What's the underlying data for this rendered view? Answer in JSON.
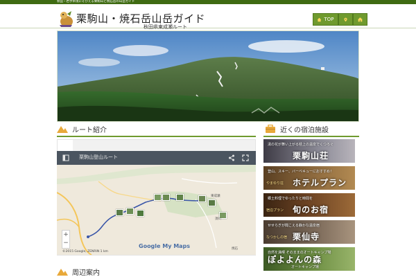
{
  "topbar": {
    "tagline": "秋田・岩手県境にそびえる栗駒山と焼石岳の山岳ガイド"
  },
  "header": {
    "title": "栗駒山・焼石岳山岳ガイド",
    "subtitle": "秋田県東成瀬ルート",
    "nav": [
      {
        "label": "TOP",
        "icon": "home-icon"
      },
      {
        "label": "",
        "icon": "pin-icon"
      },
      {
        "label": "",
        "icon": "hotel-icon"
      }
    ]
  },
  "main": {
    "section_title": "ルート紹介",
    "map": {
      "toolbar_title": "栗駒山登山ルート",
      "zoom_in": "+",
      "zoom_out": "−",
      "logo": "Google My Maps",
      "copyright": "©2015 Google, ZENRIN   1 km ",
      "labels": [
        "東成瀬",
        "須川",
        "焼石"
      ]
    },
    "bottom_section_title": "周辺案内"
  },
  "sidebar": {
    "section_title": "近くの宿泊施設",
    "banners": [
      {
        "line1": "湯の花が舞い上がる極上の温泉でくつろぐ",
        "big": "栗駒山荘",
        "small": "",
        "color": "#6c6a73"
      },
      {
        "line1": "登山、スキー、バーベキューにおすすめ！",
        "big": "ホテルプラン",
        "small": "やまゆり荘",
        "color": "#7c5a3a"
      },
      {
        "line1": "郷土料理でゆったりと時間を",
        "big": "旬のお宿",
        "small": "宿泊プラン",
        "color": "#5b3a1f"
      },
      {
        "line1": "せせらぎが聞こえる静かな温泉宿",
        "big": "栗仙寺",
        "small": "なつかしの宿",
        "color": "#6b5a4c"
      },
      {
        "line1": "自然を満喫 そのままのオートキャンプ場",
        "big": "ぽよよんの森",
        "small": "オートキャンプ場",
        "color": "#5c7a3c"
      }
    ]
  }
}
